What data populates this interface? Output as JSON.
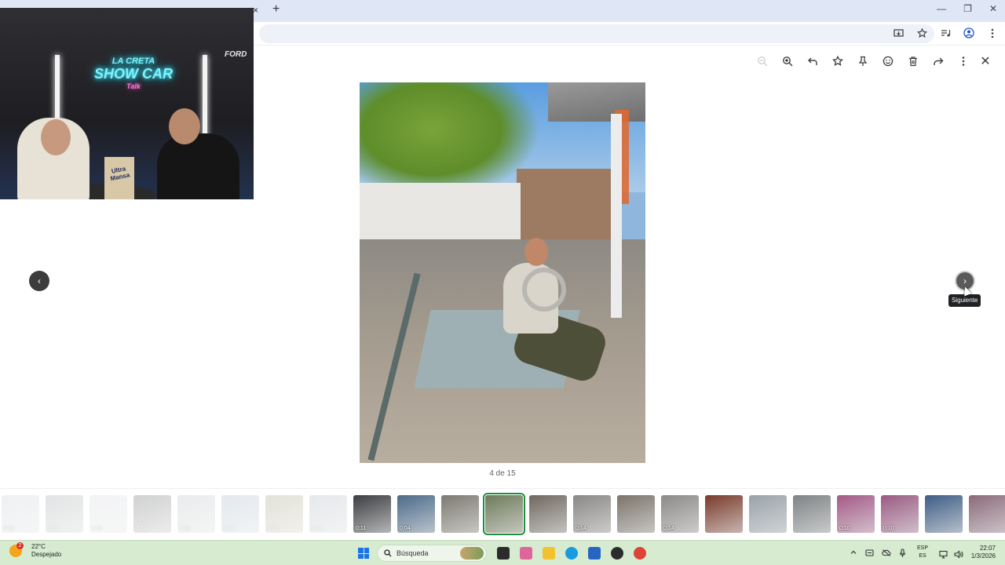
{
  "browser": {
    "tab_close": "×",
    "new_tab": "+",
    "window_controls": [
      "—",
      "❐",
      "✕"
    ]
  },
  "webcam": {
    "neon_line1": "LA CRETA",
    "neon_line2": "SHOW CAR",
    "neon_line3": "Talk",
    "bag_text": "Ultra Mansa",
    "ford_text": "FORD"
  },
  "viewer": {
    "actions": [
      "zoom-out",
      "zoom-in",
      "rotate",
      "favorite",
      "pin",
      "emoji",
      "delete",
      "share",
      "more"
    ],
    "counter": "4 de 15",
    "tooltip": "Siguiente",
    "prev_glyph": "‹",
    "next_glyph": "›",
    "close_glyph": "✕"
  },
  "filmstrip": [
    {
      "dur": "0:51",
      "color": "#c8cdd2",
      "faded": true
    },
    {
      "dur": "1:05",
      "color": "#9aa0a2",
      "faded": true
    },
    {
      "dur": "1:11",
      "color": "#d5d8dc",
      "faded": true
    },
    {
      "dur": "1:32",
      "color": "#5a5c5f",
      "faded": true
    },
    {
      "dur": "1:01",
      "color": "#b8bcbf",
      "faded": true
    },
    {
      "dur": "0:14",
      "color": "#9fb2c4",
      "faded": true
    },
    {
      "dur": "0:33",
      "color": "#9b9870",
      "faded": true
    },
    {
      "dur": "0:21",
      "color": "#a7b0bb",
      "faded": true
    },
    {
      "dur": "0:11",
      "color": "#3b3d40",
      "faded": false
    },
    {
      "dur": "0:04",
      "color": "#4b6a8a",
      "faded": false
    },
    {
      "dur": "",
      "color": "#7c7a70",
      "faded": false
    },
    {
      "dur": "",
      "color": "#6e7a5a",
      "faded": false,
      "selected": true
    },
    {
      "dur": "",
      "color": "#6f6860",
      "faded": false
    },
    {
      "dur": "0:14",
      "color": "#8a8886",
      "faded": false
    },
    {
      "dur": "",
      "color": "#7a746a",
      "faded": false
    },
    {
      "dur": "0:14",
      "color": "#8c8a88",
      "faded": false
    },
    {
      "dur": "",
      "color": "#7a3a2a",
      "faded": false
    },
    {
      "dur": "",
      "color": "#9aa3aa",
      "faded": false
    },
    {
      "dur": "",
      "color": "#7f8385",
      "faded": false
    },
    {
      "dur": "0:10",
      "color": "#a45a86",
      "faded": false
    },
    {
      "dur": "0:10",
      "color": "#9a5a82",
      "faded": false
    },
    {
      "dur": "",
      "color": "#3d5d86",
      "faded": false
    },
    {
      "dur": "",
      "color": "#8a6a7a",
      "faded": false
    }
  ],
  "taskbar": {
    "temperature": "22°C",
    "condition": "Despejado",
    "badge": "2",
    "search_label": "Búsqueda",
    "lang_line1": "ESP",
    "lang_line2": "ES",
    "time": "22:07",
    "date": "1/3/2026",
    "apps": [
      {
        "name": "task-view-icon",
        "color": "#2b2b2b"
      },
      {
        "name": "copilot-icon",
        "color": "#e0659a"
      },
      {
        "name": "file-explorer-icon",
        "color": "#f2c230"
      },
      {
        "name": "edge-icon",
        "color": "#1a9be0"
      },
      {
        "name": "store-icon",
        "color": "#2666c2"
      },
      {
        "name": "obs-icon",
        "color": "#2c2c2c"
      },
      {
        "name": "chrome-icon",
        "color": "#db4437"
      }
    ]
  }
}
